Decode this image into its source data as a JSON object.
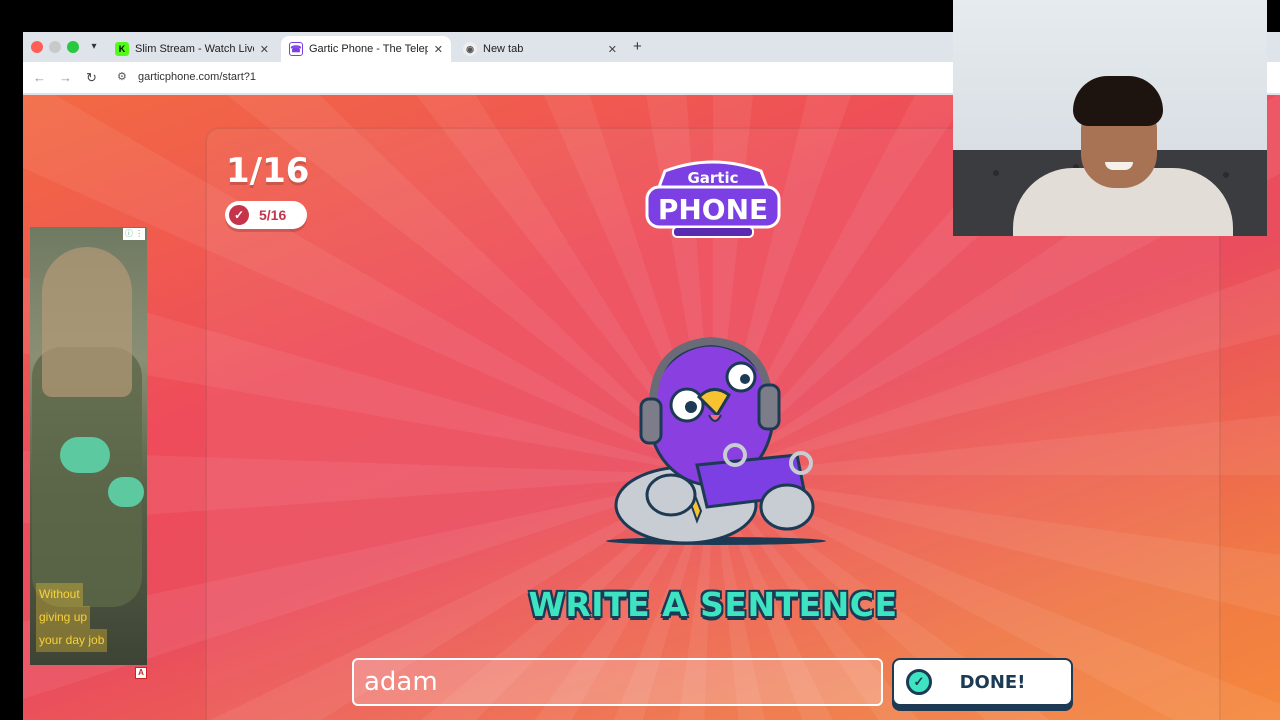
{
  "browser": {
    "tabs": [
      {
        "label": "Slim Stream - Watch Live on",
        "favicon": "kick-favicon",
        "active": false
      },
      {
        "label": "Gartic Phone - The Telephone",
        "favicon": "gartic-favicon",
        "active": true
      },
      {
        "label": "New tab",
        "favicon": "chrome-favicon",
        "active": false
      }
    ],
    "new_tab": "+",
    "url": "garticphone.com/start?1"
  },
  "game": {
    "round": "1/16",
    "players_done": "5/16",
    "logo_top": "Gartic",
    "logo_bottom": "PHONE",
    "prompt": "WRITE A SENTENCE",
    "input_value": "adam",
    "done_label": "DONE!",
    "accent_color": "#3ee3c1",
    "outline_color": "#1d3a55"
  },
  "ad": {
    "lines": [
      "Without",
      "giving up",
      "your day job"
    ],
    "badge": "A"
  },
  "icons": {
    "back": "back-arrow-icon",
    "forward": "forward-arrow-icon",
    "reload": "reload-icon",
    "site_info": "site-info-icon",
    "check": "check-icon"
  }
}
